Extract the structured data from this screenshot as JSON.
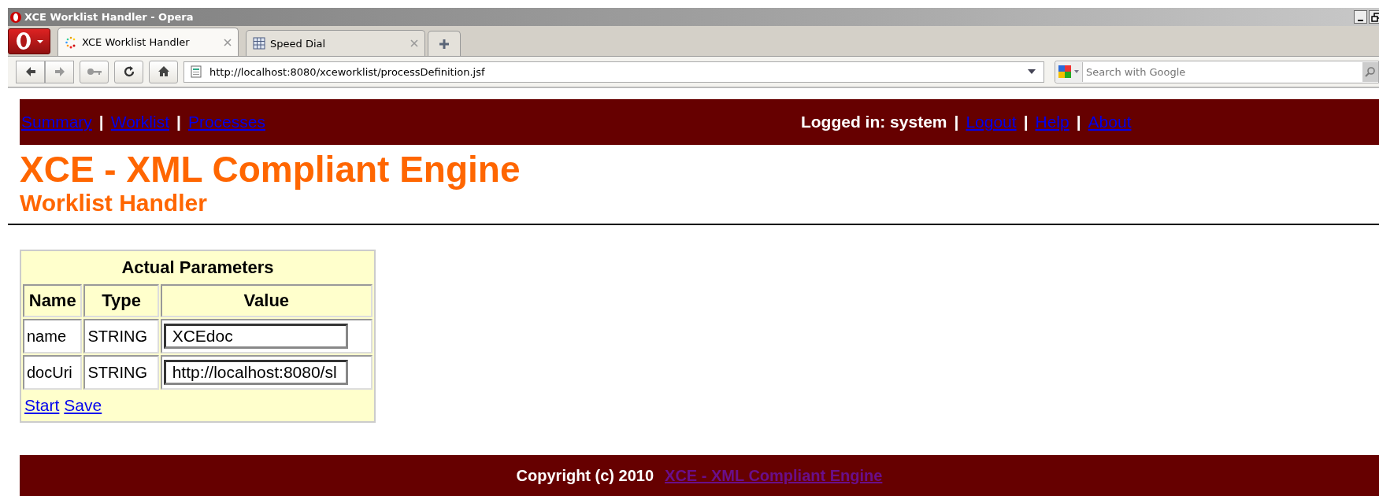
{
  "window": {
    "title": "XCE Worklist Handler - Opera"
  },
  "tabs": [
    {
      "label": "XCE Worklist Handler",
      "selected": true
    },
    {
      "label": "Speed Dial",
      "selected": false
    }
  ],
  "address": {
    "value": "http://localhost:8080/xceworklist/processDefinition.jsf"
  },
  "search": {
    "placeholder": "Search with Google"
  },
  "nav_left": [
    {
      "kind": "link",
      "text": "Summary"
    },
    {
      "kind": "separator",
      "text": "|"
    },
    {
      "kind": "link",
      "text": "Worklist"
    },
    {
      "kind": "separator",
      "text": "|"
    },
    {
      "kind": "link",
      "text": "Processes"
    }
  ],
  "nav_right": [
    {
      "kind": "label",
      "text": "Logged in: system"
    },
    {
      "kind": "separator",
      "text": "|"
    },
    {
      "kind": "link",
      "text": "Logout"
    },
    {
      "kind": "separator",
      "text": "|"
    },
    {
      "kind": "link",
      "text": "Help"
    },
    {
      "kind": "separator",
      "text": "|"
    },
    {
      "kind": "link",
      "text": "About"
    }
  ],
  "title": "XCE - XML Compliant Engine",
  "subtitle": "Worklist Handler",
  "table": {
    "caption": "Actual Parameters",
    "columns": [
      "Name",
      "Type",
      "Value"
    ],
    "rows": [
      {
        "name": "name",
        "type": "STRING",
        "value": "XCEdoc"
      },
      {
        "name": "docUri",
        "type": "STRING",
        "value": "http://localhost:8080/sl"
      }
    ],
    "actions": [
      "Start",
      "Save"
    ]
  },
  "footer": {
    "text": "Copyright (c) 2010",
    "link": {
      "text": "XCE - XML Compliant Engine",
      "visited": true
    }
  }
}
